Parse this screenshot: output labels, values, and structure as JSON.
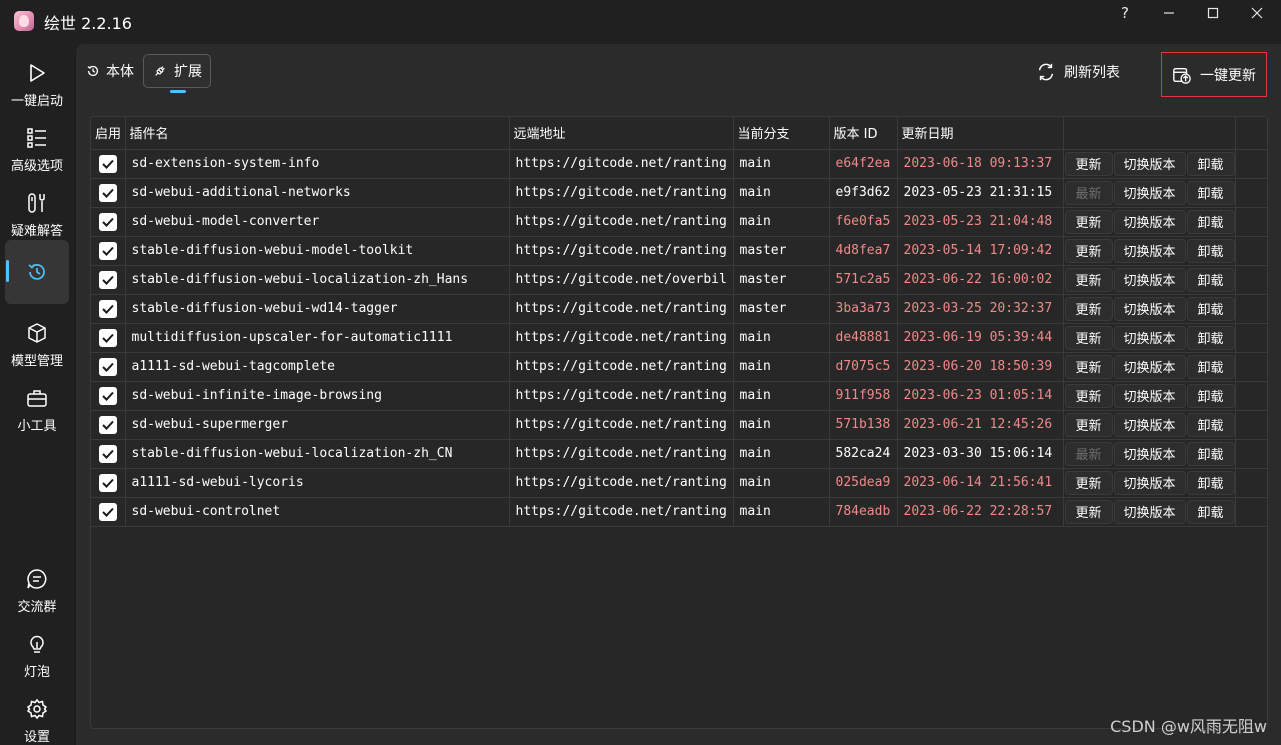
{
  "app": {
    "title": "绘世 2.2.16"
  },
  "window_controls": {
    "help": "?",
    "minimize": "—",
    "maximize": "☐",
    "close": "✕"
  },
  "sidebar": {
    "items": [
      {
        "label": "一键启动",
        "icon": "play-icon"
      },
      {
        "label": "高级选项",
        "icon": "list-icon"
      },
      {
        "label": "疑难解答",
        "icon": "wrench-icon"
      },
      {
        "label": "",
        "icon": "history-icon",
        "active": true
      },
      {
        "label": "模型管理",
        "icon": "cube-icon"
      },
      {
        "label": "小工具",
        "icon": "toolbox-icon"
      }
    ],
    "bottom_items": [
      {
        "label": "交流群",
        "icon": "chat-icon"
      },
      {
        "label": "灯泡",
        "icon": "bulb-icon"
      },
      {
        "label": "设置",
        "icon": "gear-icon"
      }
    ]
  },
  "tabs": [
    {
      "label": "本体",
      "icon": "history-icon",
      "selected": false
    },
    {
      "label": "扩展",
      "icon": "plug-icon",
      "selected": true
    }
  ],
  "actions": {
    "refresh": "刷新列表",
    "update_all": "一键更新"
  },
  "table": {
    "columns": [
      "启用",
      "插件名",
      "远端地址",
      "当前分支",
      "版本 ID",
      "更新日期"
    ],
    "button_labels": {
      "update": "更新",
      "latest": "最新",
      "switch": "切换版本",
      "uninstall": "卸载"
    },
    "rows": [
      {
        "name": "sd-extension-system-info",
        "url": "https://gitcode.net/ranting",
        "branch": "main",
        "version": "e64f2ea",
        "date": "2023-06-18 09:13:37",
        "stale": true
      },
      {
        "name": "sd-webui-additional-networks",
        "url": "https://gitcode.net/ranting",
        "branch": "main",
        "version": "e9f3d62",
        "date": "2023-05-23 21:31:15",
        "stale": false
      },
      {
        "name": "sd-webui-model-converter",
        "url": "https://gitcode.net/ranting",
        "branch": "main",
        "version": "f6e0fa5",
        "date": "2023-05-23 21:04:48",
        "stale": true
      },
      {
        "name": "stable-diffusion-webui-model-toolkit",
        "url": "https://gitcode.net/ranting",
        "branch": "master",
        "version": "4d8fea7",
        "date": "2023-05-14 17:09:42",
        "stale": true
      },
      {
        "name": "stable-diffusion-webui-localization-zh_Hans",
        "url": "https://gitcode.net/overbil",
        "branch": "master",
        "version": "571c2a5",
        "date": "2023-06-22 16:00:02",
        "stale": true
      },
      {
        "name": "stable-diffusion-webui-wd14-tagger",
        "url": "https://gitcode.net/ranting",
        "branch": "master",
        "version": "3ba3a73",
        "date": "2023-03-25 20:32:37",
        "stale": true
      },
      {
        "name": "multidiffusion-upscaler-for-automatic1111",
        "url": "https://gitcode.net/ranting",
        "branch": "main",
        "version": "de48881",
        "date": "2023-06-19 05:39:44",
        "stale": true
      },
      {
        "name": "a1111-sd-webui-tagcomplete",
        "url": "https://gitcode.net/ranting",
        "branch": "main",
        "version": "d7075c5",
        "date": "2023-06-20 18:50:39",
        "stale": true
      },
      {
        "name": "sd-webui-infinite-image-browsing",
        "url": "https://gitcode.net/ranting",
        "branch": "main",
        "version": "911f958",
        "date": "2023-06-23 01:05:14",
        "stale": true
      },
      {
        "name": "sd-webui-supermerger",
        "url": "https://gitcode.net/ranting",
        "branch": "main",
        "version": "571b138",
        "date": "2023-06-21 12:45:26",
        "stale": true
      },
      {
        "name": "stable-diffusion-webui-localization-zh_CN",
        "url": "https://gitcode.net/ranting",
        "branch": "main",
        "version": "582ca24",
        "date": "2023-03-30 15:06:14",
        "stale": false
      },
      {
        "name": "a1111-sd-webui-lycoris",
        "url": "https://gitcode.net/ranting",
        "branch": "main",
        "version": "025dea9",
        "date": "2023-06-14 21:56:41",
        "stale": true
      },
      {
        "name": "sd-webui-controlnet",
        "url": "https://gitcode.net/ranting",
        "branch": "main",
        "version": "784eadb",
        "date": "2023-06-22 22:28:57",
        "stale": true
      }
    ]
  },
  "watermark": "CSDN @w风雨无阻w",
  "colors": {
    "accent": "#4cc2ff",
    "stale_text": "#ef8a8a",
    "highlight_border": "#e0393e"
  }
}
